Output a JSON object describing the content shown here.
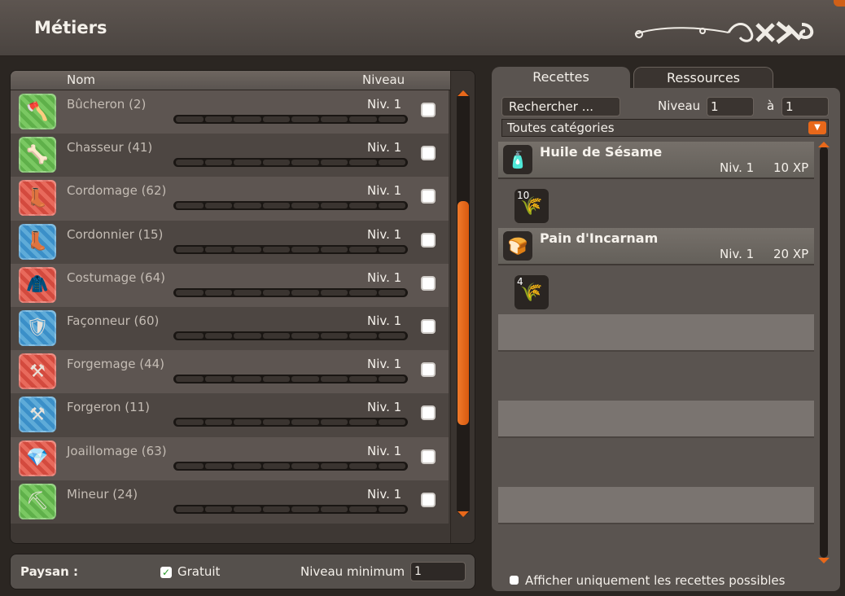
{
  "window": {
    "title": "Métiers"
  },
  "jobs_list": {
    "header_name": "Nom",
    "header_level": "Niveau",
    "items": [
      {
        "name": "Bûcheron (2)",
        "level": "Niv. 1",
        "icon": "axe-icon",
        "color": "green",
        "glyph": "🪓"
      },
      {
        "name": "Chasseur (41)",
        "level": "Niv. 1",
        "icon": "hunter-icon",
        "color": "green",
        "glyph": "🦴"
      },
      {
        "name": "Cordomage (62)",
        "level": "Niv. 1",
        "icon": "boot-magic-icon",
        "color": "red",
        "glyph": "👢"
      },
      {
        "name": "Cordonnier (15)",
        "level": "Niv. 1",
        "icon": "boot-icon",
        "color": "blue",
        "glyph": "👢"
      },
      {
        "name": "Costumage (64)",
        "level": "Niv. 1",
        "icon": "costume-magic-icon",
        "color": "red",
        "glyph": "🧥"
      },
      {
        "name": "Façonneur (60)",
        "level": "Niv. 1",
        "icon": "shield-craft-icon",
        "color": "blue",
        "glyph": "🛡"
      },
      {
        "name": "Forgemage (44)",
        "level": "Niv. 1",
        "icon": "forge-magic-icon",
        "color": "red",
        "glyph": "⚒"
      },
      {
        "name": "Forgeron (11)",
        "level": "Niv. 1",
        "icon": "forge-icon",
        "color": "blue",
        "glyph": "⚒"
      },
      {
        "name": "Joaillomage (63)",
        "level": "Niv. 1",
        "icon": "jewel-magic-icon",
        "color": "red",
        "glyph": "💎"
      },
      {
        "name": "Mineur (24)",
        "level": "Niv. 1",
        "icon": "pickaxe-icon",
        "color": "green",
        "glyph": "⛏"
      }
    ]
  },
  "paysan_bar": {
    "label": "Paysan :",
    "gratuit_label": "Gratuit",
    "niveau_min_label": "Niveau minimum",
    "niveau_min_value": "1"
  },
  "tabs": {
    "recettes": "Recettes",
    "ressources": "Ressources"
  },
  "filters": {
    "search_placeholder": "Rechercher ...",
    "niveau_label": "Niveau",
    "niveau_from": "1",
    "a_label": "à",
    "niveau_to": "1",
    "category": "Toutes catégories"
  },
  "recipes": [
    {
      "name": "Huile de Sésame",
      "level": "Niv. 1",
      "xp": "10 XP",
      "icon": "oil-flask-icon",
      "glyph": "🧴",
      "ingredients": [
        {
          "qty": "10",
          "icon": "sesame-seeds-icon",
          "glyph": "🌾"
        }
      ]
    },
    {
      "name": "Pain d'Incarnam",
      "level": "Niv. 1",
      "xp": "20 XP",
      "icon": "bread-icon",
      "glyph": "🍞",
      "ingredients": [
        {
          "qty": "4",
          "icon": "wheat-icon",
          "glyph": "🌾"
        }
      ]
    }
  ],
  "footer": {
    "only_possible_label": "Afficher uniquement les recettes possibles"
  },
  "colors": {
    "accent": "#e8681a",
    "checkbox_green": "#2a9a2a"
  }
}
